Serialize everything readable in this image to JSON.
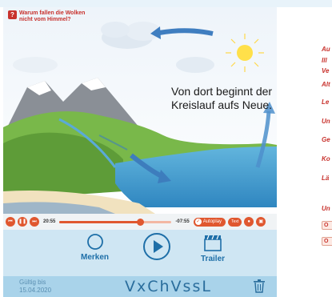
{
  "video": {
    "question": "Warum fallen die Wolken nicht vom Himmel?",
    "caption_line1": "Von dort beginnt der",
    "caption_line2": "Kreislauf aufs Neue."
  },
  "player": {
    "elapsed": "20:55",
    "remaining": "-07:55",
    "progress_fraction": 0.72,
    "autoplay_label": "Autoplay",
    "option_label": "Text"
  },
  "actions": {
    "bookmark_label": "Merken",
    "trailer_label": "Trailer"
  },
  "footer": {
    "valid_label": "Gültig bis",
    "valid_date": "15.04.2020",
    "code": "VxChVssL"
  },
  "sidebar": {
    "items": [
      "Au",
      "Ill",
      "Ve",
      "Alt",
      "Le",
      "Un",
      "Ge",
      "Ko",
      "Lä",
      "Un"
    ],
    "tags": [
      "O",
      "O"
    ]
  },
  "colors": {
    "accent": "#e0572f",
    "brand_blue": "#1e6fa8",
    "card_bg": "#cfe6f3",
    "footer_bg": "#a9d3ea"
  }
}
